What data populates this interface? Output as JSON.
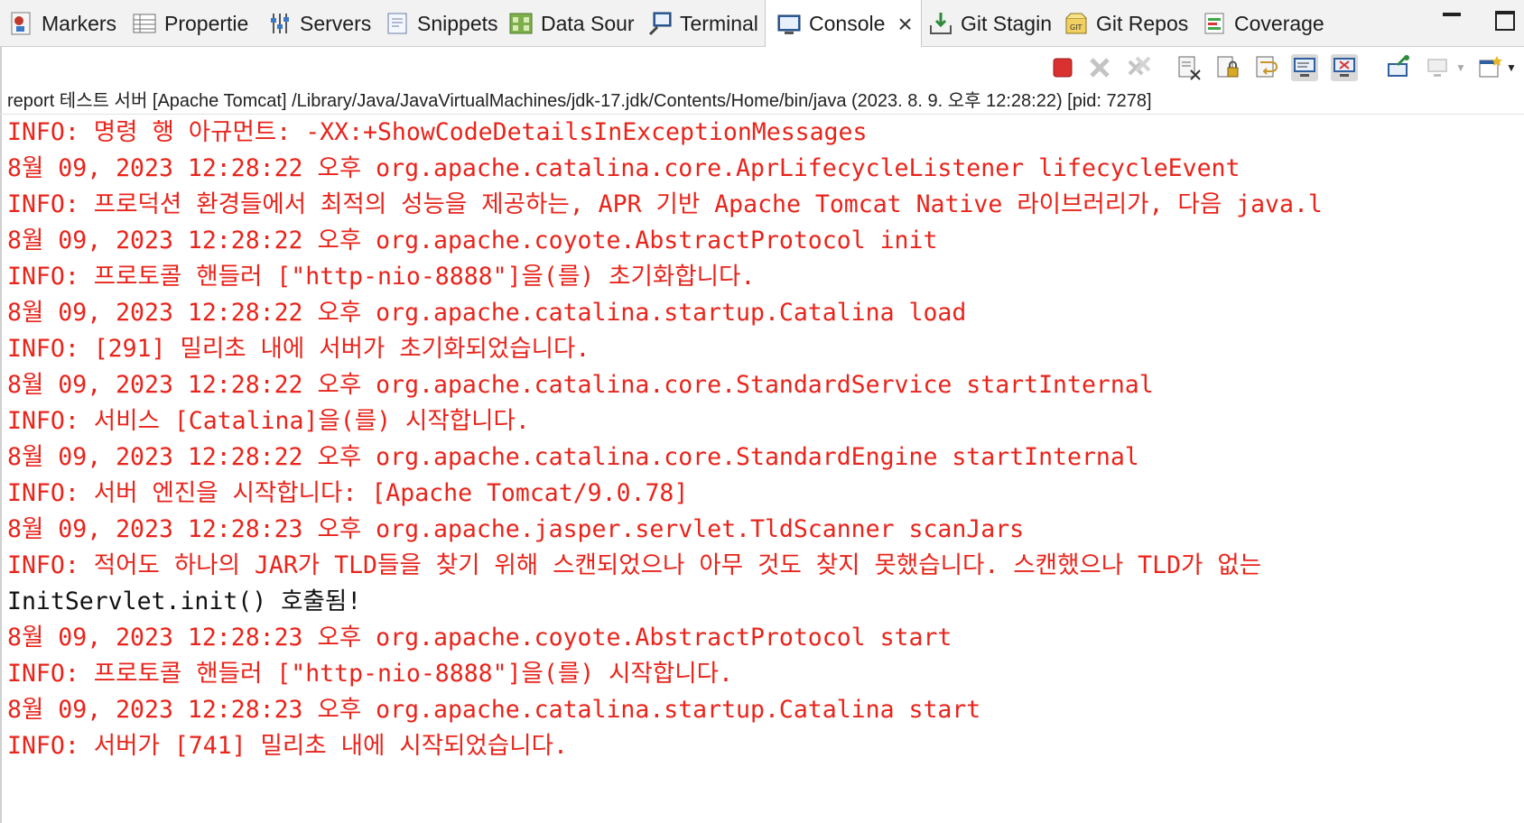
{
  "tabs": [
    {
      "label": "Markers",
      "icon": "markers-icon"
    },
    {
      "label": "Propertie",
      "icon": "properties-icon"
    },
    {
      "label": "Servers",
      "icon": "servers-icon"
    },
    {
      "label": "Snippets",
      "icon": "snippets-icon"
    },
    {
      "label": "Data Sour",
      "icon": "data-source-icon"
    },
    {
      "label": "Terminal",
      "icon": "terminal-icon"
    },
    {
      "label": "Console",
      "icon": "console-icon",
      "active": true
    },
    {
      "label": "Git Stagin",
      "icon": "git-staging-icon"
    },
    {
      "label": "Git Repos",
      "icon": "git-repos-icon"
    },
    {
      "label": "Coverage",
      "icon": "coverage-icon"
    }
  ],
  "colors": {
    "error_text": "#e8241b",
    "normal_text": "#111111",
    "terminate_red": "#d93030",
    "toolbar_bg": "#f2f2f2"
  },
  "toolbar_icons": [
    "terminate-icon",
    "remove-launch-icon",
    "remove-all-terminated-icon",
    "clear-console-icon",
    "scroll-lock-icon",
    "word-wrap-icon",
    "show-on-stdout-icon",
    "show-on-stderr-icon",
    "pin-console-icon",
    "display-selected-console-icon",
    "open-console-icon"
  ],
  "console": {
    "process_line": "report 테스트 서버 [Apache Tomcat] /Library/Java/JavaVirtualMachines/jdk-17.jdk/Contents/Home/bin/java  (2023. 8. 9. 오후 12:28:22) [pid: 7278]",
    "lines": [
      {
        "text": "INFO: 명령 행 아규먼트:  -XX:+ShowCodeDetailsInExceptionMessages",
        "stream": "err"
      },
      {
        "text": "8월 09, 2023 12:28:22 오후 org.apache.catalina.core.AprLifecycleListener lifecycleEvent",
        "stream": "err"
      },
      {
        "text": "INFO: 프로덕션 환경들에서 최적의 성능을 제공하는, APR 기반 Apache Tomcat Native 라이브러리가, 다음 java.l",
        "stream": "err"
      },
      {
        "text": "8월 09, 2023 12:28:22 오후 org.apache.coyote.AbstractProtocol init",
        "stream": "err"
      },
      {
        "text": "INFO: 프로토콜 핸들러 [\"http-nio-8888\"]을(를) 초기화합니다.",
        "stream": "err"
      },
      {
        "text": "8월 09, 2023 12:28:22 오후 org.apache.catalina.startup.Catalina load",
        "stream": "err"
      },
      {
        "text": "INFO: [291] 밀리초 내에 서버가 초기화되었습니다.",
        "stream": "err"
      },
      {
        "text": "8월 09, 2023 12:28:22 오후 org.apache.catalina.core.StandardService startInternal",
        "stream": "err"
      },
      {
        "text": "INFO: 서비스 [Catalina]을(를) 시작합니다.",
        "stream": "err"
      },
      {
        "text": "8월 09, 2023 12:28:22 오후 org.apache.catalina.core.StandardEngine startInternal",
        "stream": "err"
      },
      {
        "text": "INFO: 서버 엔진을 시작합니다: [Apache Tomcat/9.0.78]",
        "stream": "err"
      },
      {
        "text": "8월 09, 2023 12:28:23 오후 org.apache.jasper.servlet.TldScanner scanJars",
        "stream": "err"
      },
      {
        "text": "INFO: 적어도 하나의 JAR가 TLD들을 찾기 위해 스캔되었으나 아무 것도 찾지 못했습니다. 스캔했으나 TLD가 없는",
        "stream": "err"
      },
      {
        "text": "InitServlet.init() 호출됨!",
        "stream": "out"
      },
      {
        "text": "8월 09, 2023 12:28:23 오후 org.apache.coyote.AbstractProtocol start",
        "stream": "err"
      },
      {
        "text": "INFO: 프로토콜 핸들러 [\"http-nio-8888\"]을(를) 시작합니다.",
        "stream": "err"
      },
      {
        "text": "8월 09, 2023 12:28:23 오후 org.apache.catalina.startup.Catalina start",
        "stream": "err"
      },
      {
        "text": "INFO: 서버가 [741] 밀리초 내에 시작되었습니다.",
        "stream": "err"
      }
    ]
  }
}
